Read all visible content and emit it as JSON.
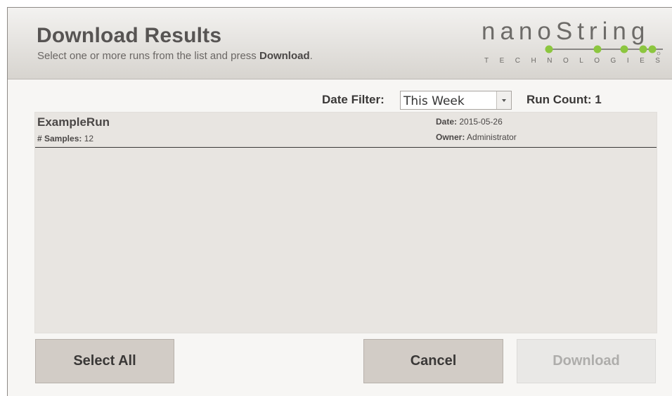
{
  "header": {
    "title": "Download Results",
    "subtitle_prefix": "Select one or more runs from the list and press ",
    "subtitle_bold": "Download",
    "subtitle_suffix": ".",
    "logo_word": "nanoString",
    "logo_sub": "TECHNOLOGIES",
    "logo_dot_color": "#8cc63f"
  },
  "filter": {
    "label": "Date Filter:",
    "selected": "This Week",
    "run_count_label": "Run Count:",
    "run_count": "1"
  },
  "runs": [
    {
      "name": "ExampleRun",
      "samples_label": "# Samples:",
      "samples": "12",
      "date_label": "Date:",
      "date": "2015-05-26",
      "owner_label": "Owner:",
      "owner": "Administrator"
    }
  ],
  "buttons": {
    "select_all": "Select All",
    "cancel": "Cancel",
    "download": "Download"
  }
}
